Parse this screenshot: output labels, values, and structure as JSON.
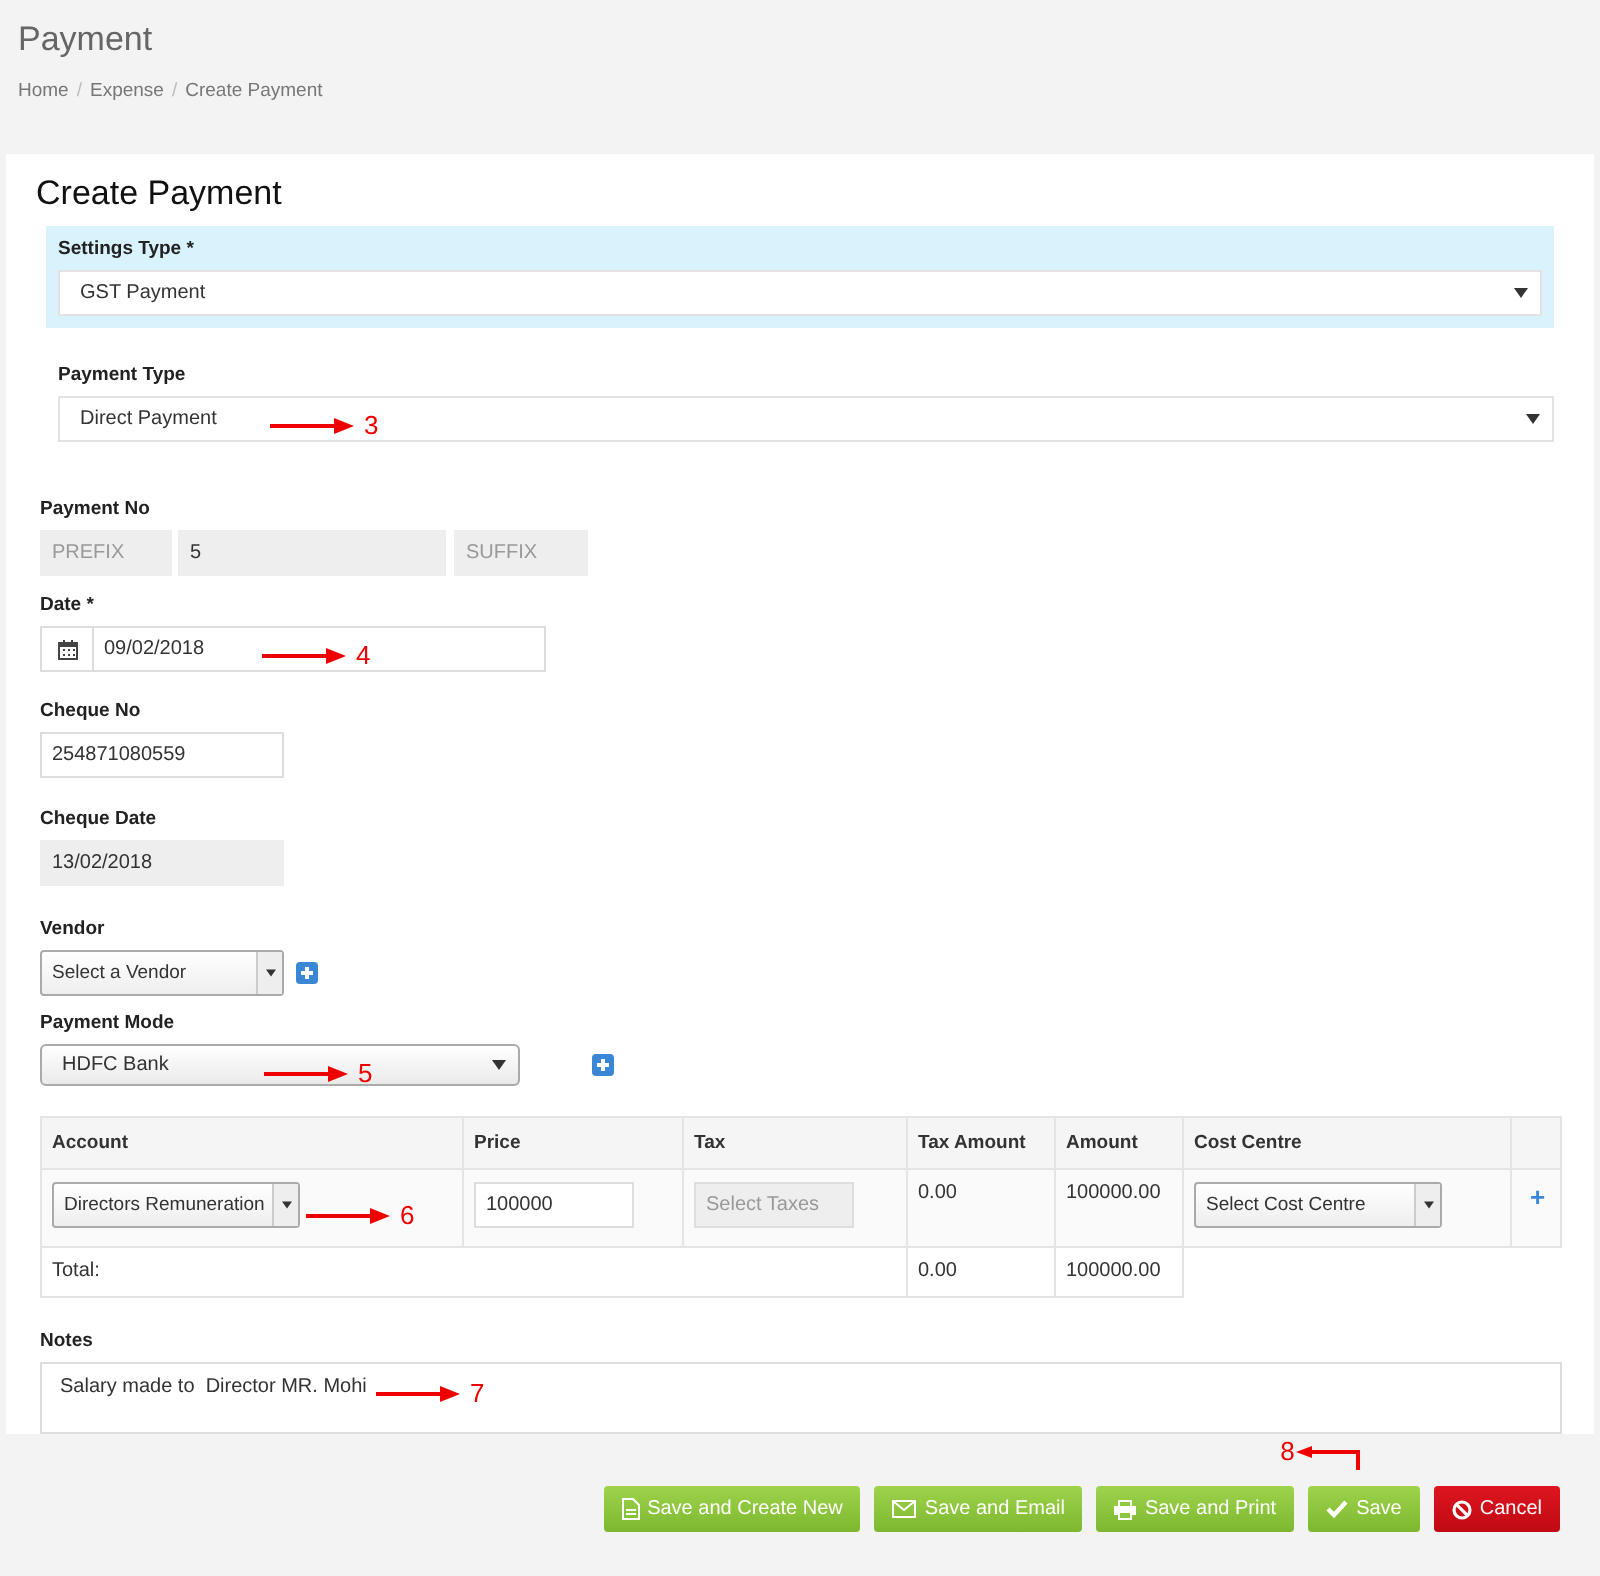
{
  "page": {
    "title": "Payment",
    "breadcrumb": [
      {
        "label": "Home",
        "separator": "/"
      },
      {
        "label": "Expense",
        "separator": "/"
      },
      {
        "label": "Create Payment"
      }
    ]
  },
  "form": {
    "title": "Create Payment",
    "settings_type": {
      "label": "Settings Type *",
      "value": "GST Payment"
    },
    "payment_type": {
      "label": "Payment Type",
      "value": "Direct Payment",
      "annotation": "3"
    },
    "payment_no": {
      "label": "Payment No",
      "prefix_placeholder": "PREFIX",
      "value": "5",
      "suffix_placeholder": "SUFFIX"
    },
    "date": {
      "label": "Date *",
      "value": "09/02/2018",
      "annotation": "4"
    },
    "cheque_no": {
      "label": "Cheque No",
      "value": "254871080559"
    },
    "cheque_date": {
      "label": "Cheque Date",
      "value": "13/02/2018"
    },
    "vendor": {
      "label": "Vendor",
      "placeholder": "Select a Vendor"
    },
    "payment_mode": {
      "label": "Payment Mode",
      "value": "HDFC Bank",
      "annotation": "5"
    },
    "table": {
      "columns": [
        "Account",
        "Price",
        "Tax",
        "Tax Amount",
        "Amount",
        "Cost Centre"
      ],
      "rows": [
        {
          "account": "Directors Remuneration",
          "annotation": "6",
          "price": "100000",
          "tax_placeholder": "Select Taxes",
          "tax_amount": "0.00",
          "amount": "100000.00",
          "cost_centre": "Select Cost Centre",
          "add": "+"
        }
      ],
      "total": {
        "label": "Total:",
        "tax_amount": "0.00",
        "amount": "100000.00"
      }
    },
    "notes": {
      "label": "Notes",
      "value": "Salary made to  Director MR. Mohi",
      "annotation": "7"
    }
  },
  "buttons": [
    {
      "label": "Save and Create New",
      "kind": "new"
    },
    {
      "label": "Save and Email",
      "kind": "email"
    },
    {
      "label": "Save and Print",
      "kind": "print"
    },
    {
      "label": "Save",
      "kind": "save",
      "annotation": "8"
    },
    {
      "label": "Cancel",
      "kind": "cancel"
    }
  ]
}
